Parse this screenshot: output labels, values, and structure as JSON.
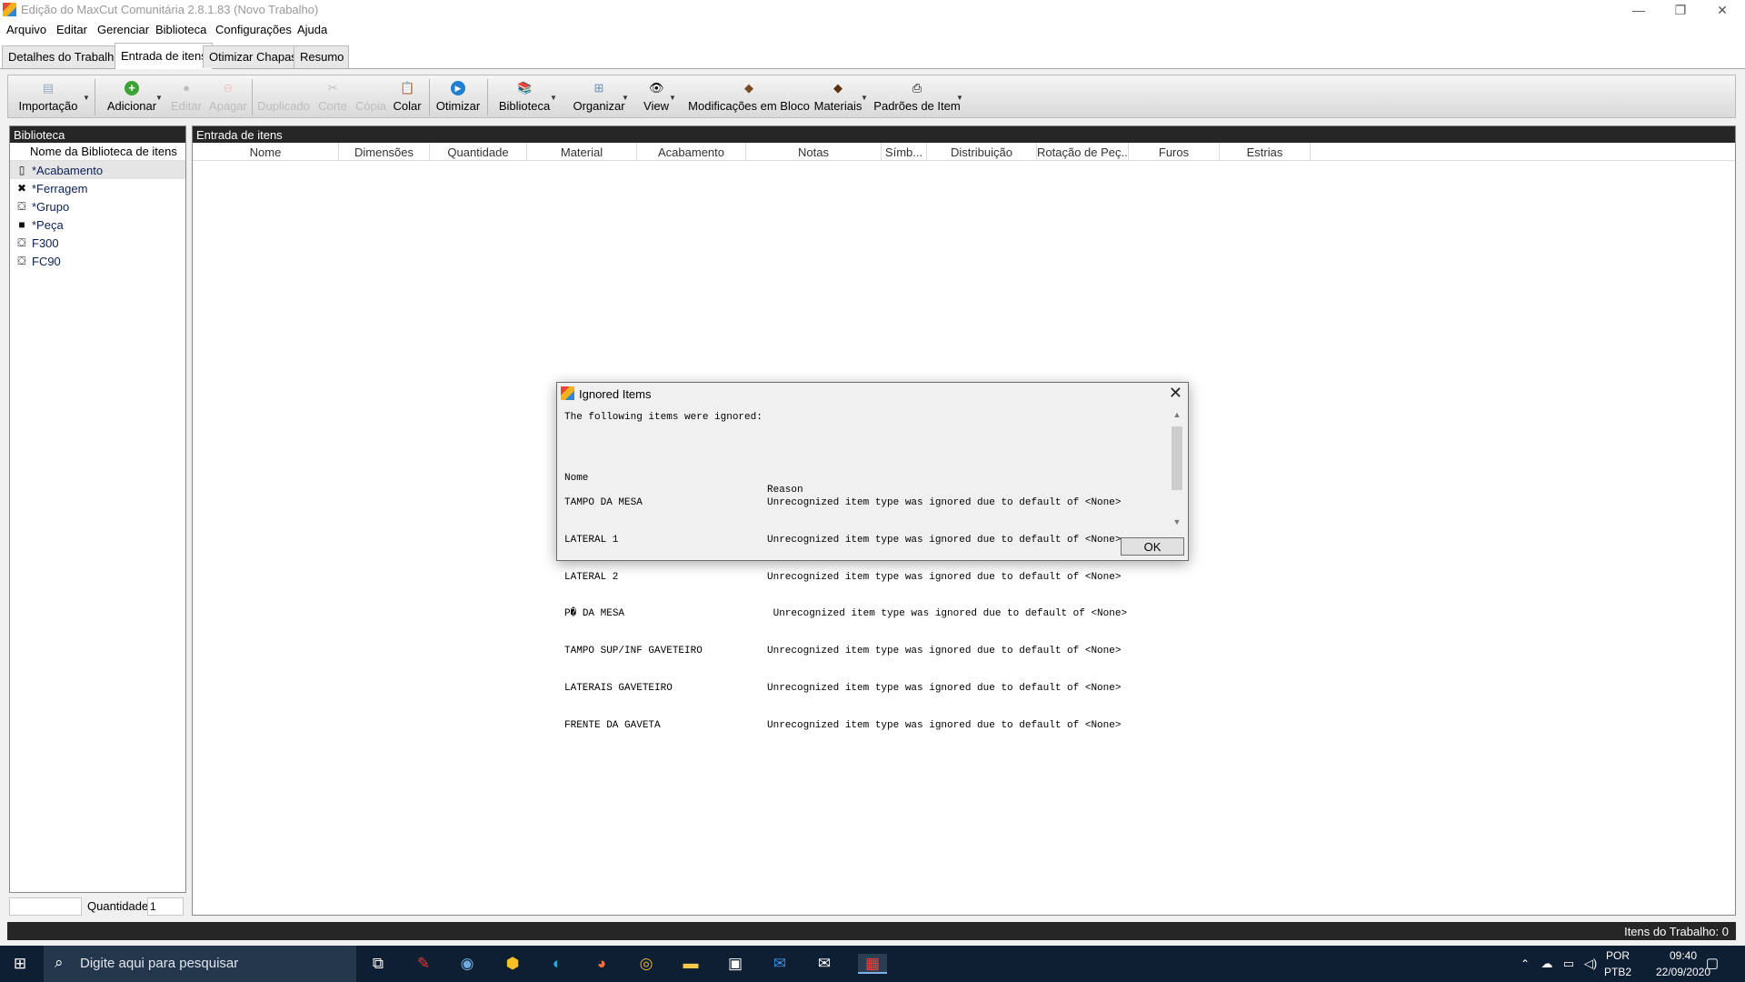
{
  "window": {
    "title": "Edição do MaxCut Comunitária 2.8.1.83 (Novo Trabalho)",
    "minimize": "—",
    "restore": "❐",
    "close": "✕"
  },
  "menu": [
    "Arquivo",
    "Editar",
    "Gerenciar",
    "Biblioteca",
    "Configurações",
    "Ajuda"
  ],
  "tabs": [
    "Detalhes do Trabalho",
    "Entrada de itens",
    "Otimizar Chapas",
    "Resumo"
  ],
  "toolbar": {
    "importacao": "Importação",
    "adicionar": "Adicionar",
    "editar": "Editar",
    "apagar": "Apagar",
    "duplicado": "Duplicado",
    "corte": "Corte",
    "copia": "Cópia",
    "colar": "Colar",
    "otimizar": "Otimizar",
    "biblioteca": "Biblioteca",
    "organizar": "Organizar",
    "view": "View",
    "modificacoes": "Modificações em Bloco",
    "materiais": "Materiais",
    "padroes": "Padrões de Item"
  },
  "library": {
    "header": "Biblioteca",
    "column": "Nome da Biblioteca de itens",
    "items": [
      "*Acabamento",
      "*Ferragem",
      "*Grupo",
      "*Peça",
      "F300",
      "FC90"
    ],
    "quantity_label": "Quantidade",
    "quantity_value": "1"
  },
  "entry": {
    "header": "Entrada de itens",
    "columns": [
      "Nome",
      "Dimensões",
      "Quantidade",
      "Material",
      "Acabamento",
      "Notas",
      "Símb...",
      "Distribuição",
      "Rotação de Peç...",
      "Furos",
      "Estrias"
    ]
  },
  "status": {
    "text": "Itens do Trabalho: 0"
  },
  "dialog": {
    "title": "Ignored Items",
    "message": "The following items were ignored:",
    "col_name": "Nome",
    "col_reason": "Reason",
    "rows": [
      {
        "name": "TAMPO DA MESA",
        "reason": "Unrecognized item type was ignored due to default of <None>"
      },
      {
        "name": "LATERAL 1",
        "reason": "Unrecognized item type was ignored due to default of <None>"
      },
      {
        "name": "LATERAL 2",
        "reason": "Unrecognized item type was ignored due to default of <None>"
      },
      {
        "name": "P� DA MESA",
        "reason": " Unrecognized item type was ignored due to default of <None>"
      },
      {
        "name": "TAMPO SUP/INF GAVETEIRO",
        "reason": "Unrecognized item type was ignored due to default of <None>"
      },
      {
        "name": "LATERAIS GAVETEIRO",
        "reason": "Unrecognized item type was ignored due to default of <None>"
      },
      {
        "name": "FRENTE DA GAVETA",
        "reason": "Unrecognized item type was ignored due to default of <None>"
      }
    ],
    "ok": "OK"
  },
  "taskbar": {
    "search_placeholder": "Digite aqui para pesquisar",
    "lang_top": "POR",
    "lang_bottom": "PTB2",
    "time": "09:40",
    "date": "22/09/2020"
  }
}
